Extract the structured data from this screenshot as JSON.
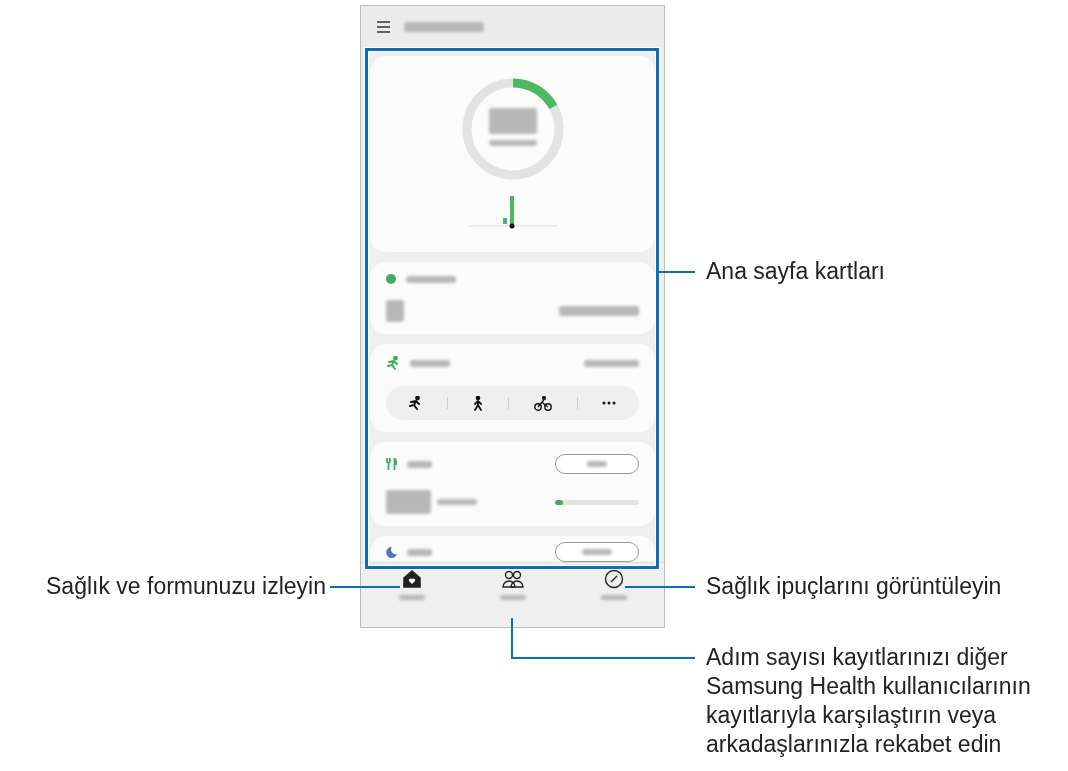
{
  "callouts": [
    {
      "text": "Ana sayfa kartları"
    },
    {
      "text": "Sağlık ve formunuzu izleyin"
    },
    {
      "text": "Sağlık ipuçlarını görüntüleyin"
    },
    {
      "text": "Adım sayısı kayıtlarınızı diğer Samsung Health kullanıcılarının kayıtlarıyla karşılaştırın veya arkadaşlarınızla rekabet edin"
    }
  ],
  "steps_ring": {
    "level": 0.17
  },
  "food": {
    "level": 0.1
  },
  "nav": [
    {
      "kind": "home",
      "selected": true
    },
    {
      "kind": "together",
      "selected": false
    },
    {
      "kind": "discover",
      "selected": false
    }
  ]
}
